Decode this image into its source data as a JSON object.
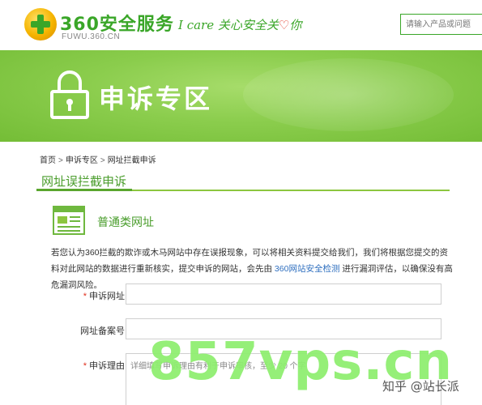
{
  "header": {
    "logo_title": "360安全服务",
    "logo_subtitle": "FUWU.360.CN",
    "slogan_prefix": "I care  关心安全关",
    "slogan_heart": "♡",
    "slogan_suffix": "你",
    "search_placeholder": "请输入产品或问题"
  },
  "banner": {
    "title": "申诉专区",
    "icon": "lock-icon"
  },
  "breadcrumb": {
    "items": [
      "首页",
      "申诉专区",
      "网址拦截申诉"
    ],
    "separator": ">"
  },
  "section": {
    "title": "网址误拦截申诉"
  },
  "category": {
    "icon": "document-icon",
    "title": "普通类网址"
  },
  "description": {
    "part1": "若您认为360拦截的欺诈或木马网站中存在误报现象，可以将相关资料提交给我们，我们将根据您提交的资料对此网站的数据进行重新核实，提交申诉的网站，会先由 ",
    "link": "360网站安全检测",
    "part2": " 进行漏洞评估，以确保没有高危漏洞风险。"
  },
  "form": {
    "url": {
      "label": "申诉网址：",
      "required": "*"
    },
    "icp": {
      "label": "网址备案号："
    },
    "reason": {
      "label": "申诉理由：",
      "required": "*",
      "placeholder": "详细填写申诉理由有利于申诉审核，至少 20 个字"
    }
  },
  "watermark": {
    "big": "857vps.cn",
    "small": "知乎 @站长派"
  },
  "colors": {
    "brand_green": "#3aa628",
    "banner_green": "#8bcd4d",
    "link_blue": "#2f6fbf",
    "required_red": "#e0301e"
  }
}
